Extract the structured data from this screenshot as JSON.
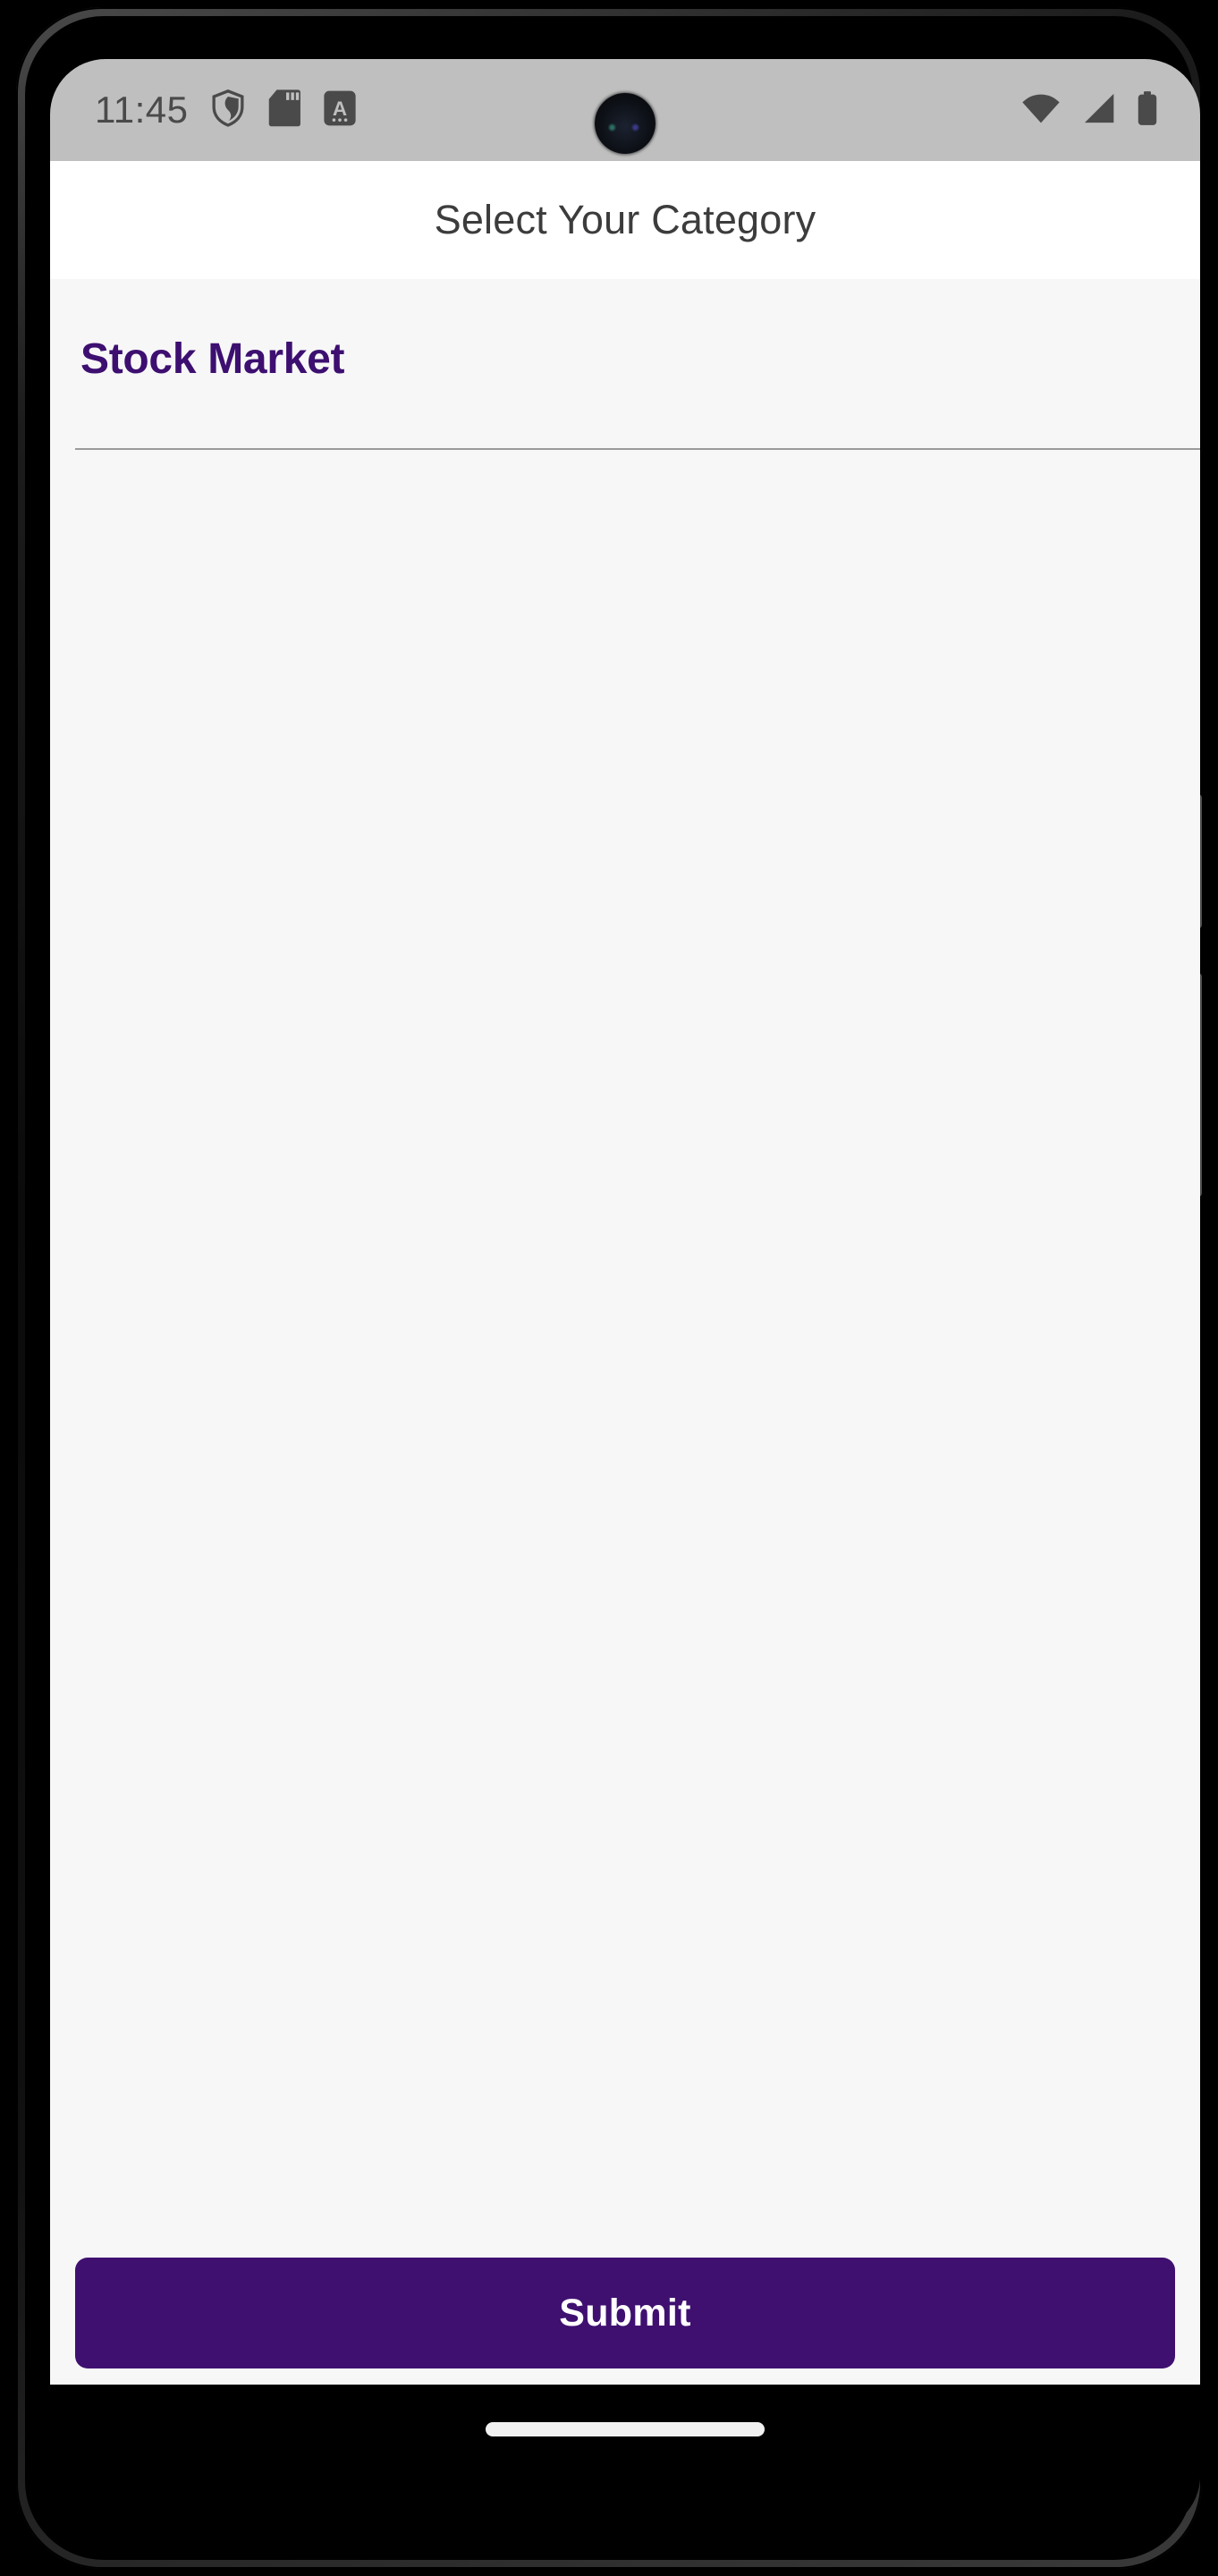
{
  "status_bar": {
    "clock": "11:45",
    "left_icons": [
      {
        "name": "shield-icon",
        "label": "shield"
      },
      {
        "name": "sd-card-icon",
        "label": "sd-card"
      },
      {
        "name": "letter-a-badge-icon",
        "label": "A"
      }
    ],
    "right_icons": [
      {
        "name": "wifi-icon",
        "label": "wifi"
      },
      {
        "name": "cellular-signal-icon",
        "label": "signal"
      },
      {
        "name": "battery-icon",
        "label": "battery"
      }
    ],
    "background_color": "#bfbfbf",
    "foreground_color": "#4a4a4a"
  },
  "app_bar": {
    "title": "Select Your Category",
    "background_color": "#ffffff",
    "title_color": "#3c3c3c"
  },
  "content": {
    "section_heading": "Stock Market",
    "heading_color": "#3d0f70",
    "background_color": "#f7f7f7",
    "options": []
  },
  "footer": {
    "submit_label": "Submit",
    "submit_background_color": "#3f1070",
    "submit_text_color": "#ffffff"
  },
  "nav_bar": {
    "background_color": "#000000",
    "gesture_pill_color": "#f1f1f1"
  }
}
